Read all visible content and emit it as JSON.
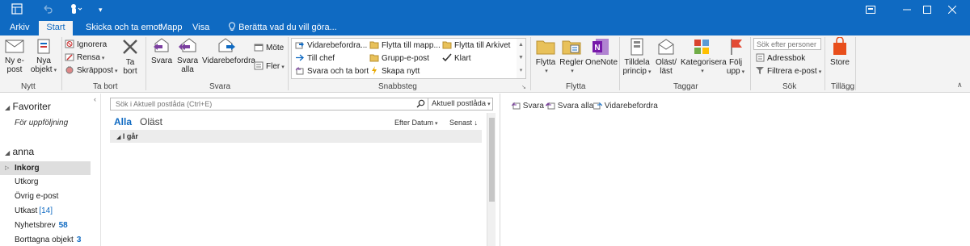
{
  "colors": {
    "brand": "#0f6ac2",
    "ribbon_bg": "#f3f3f3",
    "count": "#0f6ac2"
  },
  "qat": {
    "icons": [
      "outlook-app-icon",
      "undo-icon",
      "touch-mode-icon",
      "customize-icon"
    ]
  },
  "window": {
    "icons": [
      "restore-ribbon-icon",
      "minimize-icon",
      "maximize-icon",
      "close-icon"
    ]
  },
  "tabs": [
    {
      "label": "Arkiv"
    },
    {
      "label": "Start"
    },
    {
      "label": "Skicka och ta emot"
    },
    {
      "label": "Mapp"
    },
    {
      "label": "Visa"
    }
  ],
  "tell_me": "Berätta vad du vill göra...",
  "ribbon": {
    "new": {
      "group": "Nytt",
      "new_email": [
        "Ny e-",
        "post"
      ],
      "new_items": [
        "Nya",
        "objekt"
      ]
    },
    "delete": {
      "group": "Ta bort",
      "ignore": "Ignorera",
      "clean": "Rensa",
      "junk": "Skräppost",
      "delete": [
        "Ta",
        "bort"
      ]
    },
    "respond": {
      "group": "Svara",
      "reply": "Svara",
      "reply_all": [
        "Svara",
        "alla"
      ],
      "forward": "Vidarebefordra",
      "meeting": "Möte",
      "more": "Fler"
    },
    "quicksteps": {
      "group": "Snabbsteg",
      "items": [
        "Vidarebefordra...",
        "Till chef",
        "Svara och ta bort",
        "Flytta till mapp...",
        "Grupp-e-post",
        "Skapa nytt",
        "Flytta till Arkivet",
        "Klart"
      ]
    },
    "move": {
      "group": "Flytta",
      "move": "Flytta",
      "rules": "Regler",
      "onenote": "OneNote"
    },
    "tags": {
      "group": "Taggar",
      "assign": [
        "Tilldela",
        "princip"
      ],
      "unread": [
        "Oläst/",
        "läst"
      ],
      "categorize": "Kategorisera",
      "follow": [
        "Följ",
        "upp"
      ]
    },
    "find": {
      "group": "Sök",
      "placeholder": "Sök efter personer",
      "address_book": "Adressbok",
      "filter": "Filtrera e-post"
    },
    "addins": {
      "group": "Tillägg",
      "store": "Store"
    }
  },
  "nav": {
    "favorites_label": "Favoriter",
    "favorites": [
      {
        "label": "För uppföljning"
      }
    ],
    "account": "anna",
    "folders": [
      {
        "label": "Inkorg",
        "count": ""
      },
      {
        "label": "Utkorg",
        "count": ""
      },
      {
        "label": "Övrig e-post",
        "count": ""
      },
      {
        "label": "Utkast",
        "count": "[14]"
      },
      {
        "label": "Nyhetsbrev",
        "count": "58"
      },
      {
        "label": "Borttagna objekt",
        "count": "3"
      }
    ]
  },
  "list": {
    "search_placeholder": "Sök i Aktuell postlåda (Ctrl+E)",
    "scope": "Aktuell postlåda",
    "filter_all": "Alla",
    "filter_unread": "Oläst",
    "sort_by": "Efter Datum",
    "order": "Senast",
    "group_header": "I går"
  },
  "reading": {
    "reply": "Svara",
    "reply_all": "Svara alla",
    "forward": "Vidarebefordra"
  }
}
